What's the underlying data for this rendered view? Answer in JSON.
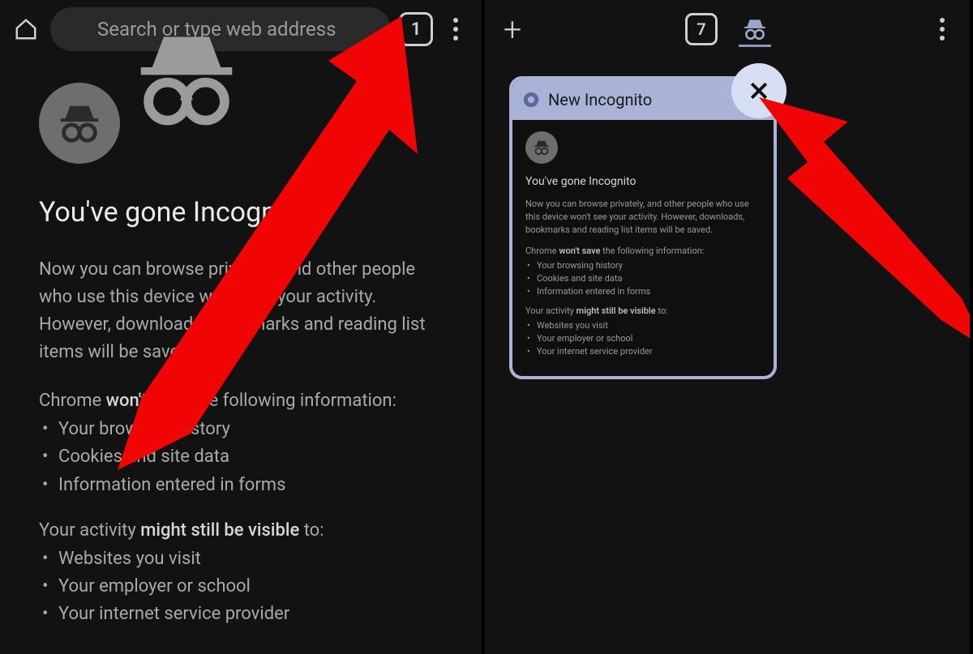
{
  "left": {
    "omnibox_placeholder": "Search or type web address",
    "tabs_count": "1",
    "heading": "You've gone Incognito",
    "paragraph": "Now you can browse privately, and other people who use this device won't see your activity. However, downloads, bookmarks and reading list items will be saved.",
    "wont_save_intro_a": "Chrome ",
    "wont_save_intro_b": "won't save",
    "wont_save_intro_c": " the following information:",
    "wont_save": [
      "Your browsing history",
      "Cookies and site data",
      "Information entered in forms"
    ],
    "visible_intro_a": "Your activity ",
    "visible_intro_b": "might still be visible",
    "visible_intro_c": " to:",
    "visible": [
      "Websites you visit",
      "Your employer or school",
      "Your internet service provider"
    ]
  },
  "right": {
    "tabs_count": "7",
    "card_title": "New Incognito",
    "card": {
      "heading": "You've gone Incognito",
      "paragraph": "Now you can browse privately, and other people who use this device won't see your activity. However, downloads, bookmarks and reading list items will be saved.",
      "wont_save_intro_a": "Chrome ",
      "wont_save_intro_b": "won't save",
      "wont_save_intro_c": " the following information:",
      "wont_save": [
        "Your browsing history",
        "Cookies and site data",
        "Information entered in forms"
      ],
      "visible_intro_a": "Your activity ",
      "visible_intro_b": "might still be visible",
      "visible_intro_c": " to:",
      "visible": [
        "Websites you visit",
        "Your employer or school",
        "Your internet service provider"
      ]
    }
  }
}
